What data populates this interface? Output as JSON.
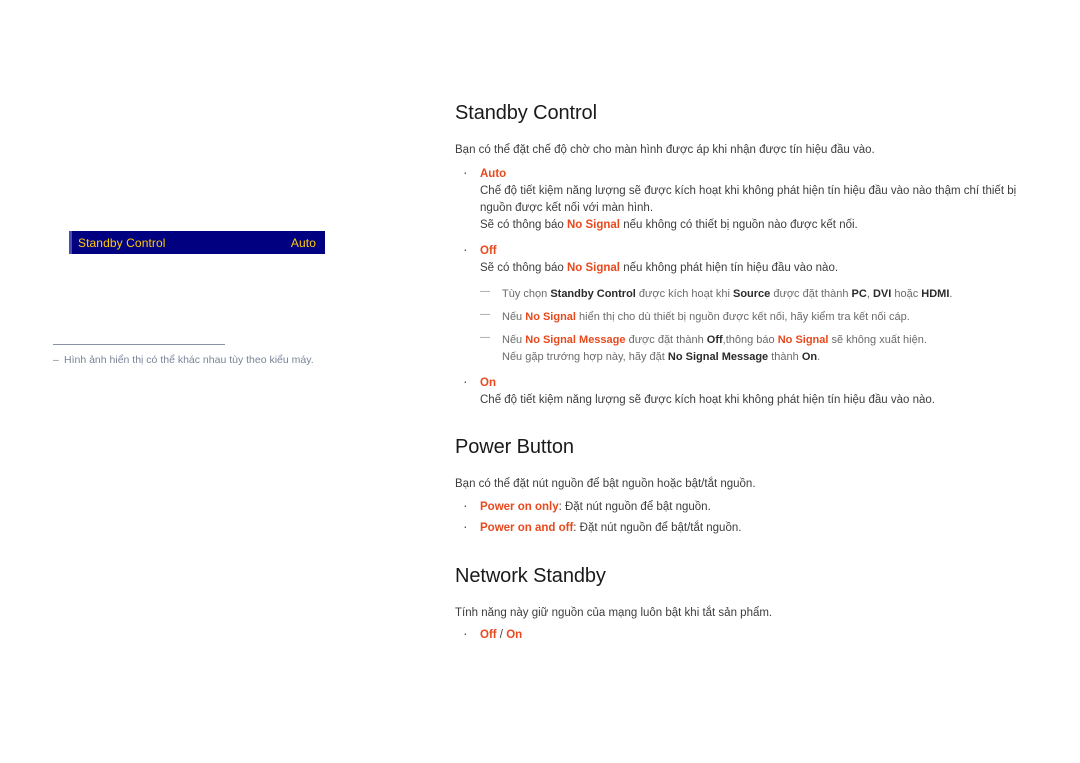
{
  "osd": {
    "label": "Standby Control",
    "value": "Auto"
  },
  "left_footnote": {
    "dash": "–",
    "text": "Hình ảnh hiển thị có thể khác nhau tùy theo kiểu máy."
  },
  "sections": {
    "standby_control": {
      "title": "Standby Control",
      "intro": "Bạn có thể đặt chế độ chờ cho màn hình được áp khi nhận được tín hiệu đầu vào.",
      "auto": {
        "name": "Auto",
        "line1": "Chế độ tiết kiệm năng lượng sẽ được kích hoạt khi không phát hiện tín hiệu đầu vào nào thậm chí thiết bị nguồn được kết nối với màn hình.",
        "line2_a": "Sẽ có thông báo ",
        "line2_kw": "No Signal",
        "line2_b": " nếu không có thiết bị nguồn nào được kết nối."
      },
      "off": {
        "name": "Off",
        "line1_a": "Sẽ có thông báo ",
        "line1_kw": "No Signal",
        "line1_b": " nếu không phát hiện tín hiệu đầu vào nào."
      },
      "notes": {
        "n1_a": "Tùy chọn ",
        "n1_kw1": "Standby Control",
        "n1_b": " được kích hoạt khi ",
        "n1_kw2": "Source",
        "n1_c": " được đặt thành ",
        "n1_kw3": "PC",
        "n1_d": ", ",
        "n1_kw4": "DVI",
        "n1_e": " hoặc ",
        "n1_kw5": "HDMI",
        "n1_f": ".",
        "n2_a": "Nếu ",
        "n2_kw": "No Signal",
        "n2_b": " hiển thị cho dù thiết bị nguồn được kết nối, hãy kiểm tra kết nối cáp.",
        "n3_a": "Nếu ",
        "n3_kw1": "No Signal Message",
        "n3_b": " được đặt thành ",
        "n3_kw2": "Off",
        "n3_c": ",thông báo ",
        "n3_kw3": "No Signal",
        "n3_d": " sẽ không xuất hiện.",
        "n3_cont_a": "Nếu gặp trướng hợp này, hãy đặt ",
        "n3_cont_kw1": "No Signal Message",
        "n3_cont_b": " thành ",
        "n3_cont_kw2": "On",
        "n3_cont_c": "."
      },
      "on": {
        "name": "On",
        "line1": "Chế độ tiết kiệm năng lượng sẽ được kích hoạt khi không phát hiện tín hiệu đầu vào nào."
      }
    },
    "power_button": {
      "title": "Power Button",
      "intro": "Bạn có thể đặt nút nguồn để bật nguồn hoặc bật/tắt nguồn.",
      "item1_kw": "Power on only",
      "item1_desc": ": Đặt nút nguồn để bật nguồn.",
      "item2_kw": "Power on and off",
      "item2_desc": ": Đặt nút nguồn để bật/tắt nguồn."
    },
    "network_standby": {
      "title": "Network Standby",
      "intro": "Tính năng này giữ nguồn của mạng luôn bật khi tắt sản phẩm.",
      "opt_off": "Off",
      "opt_sep": " / ",
      "opt_on": "On"
    }
  },
  "colors": {
    "osd_background": "#000080",
    "osd_text": "#ffcc00",
    "keyword": "#e8491d",
    "note_text": "#6b6b6b",
    "footnote_text": "#7a8397"
  }
}
